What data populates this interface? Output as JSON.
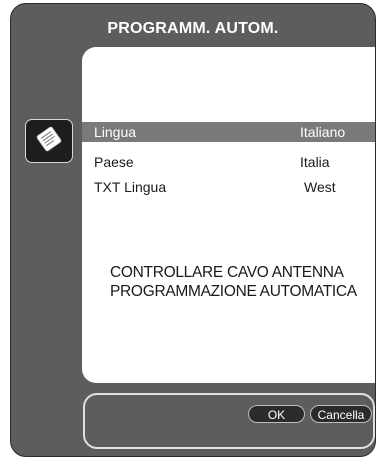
{
  "dialog": {
    "title": "PROGRAMM. AUTOM.",
    "icon": "document-icon"
  },
  "settings": [
    {
      "label": "Lingua",
      "value": "Italiano",
      "selected": true
    },
    {
      "label": "Paese",
      "value": "Italia",
      "selected": false
    },
    {
      "label": "TXT Lingua",
      "value": "West",
      "selected": false
    }
  ],
  "message": {
    "line1": "CONTROLLARE CAVO ANTENNA",
    "line2": "PROGRAMMAZIONE AUTOMATICA"
  },
  "buttons": {
    "ok": "OK",
    "cancel": "Cancella"
  },
  "colors": {
    "panel": "#5d5d5d",
    "selection": "#7a7a7a",
    "button": "#2b2b2b"
  }
}
